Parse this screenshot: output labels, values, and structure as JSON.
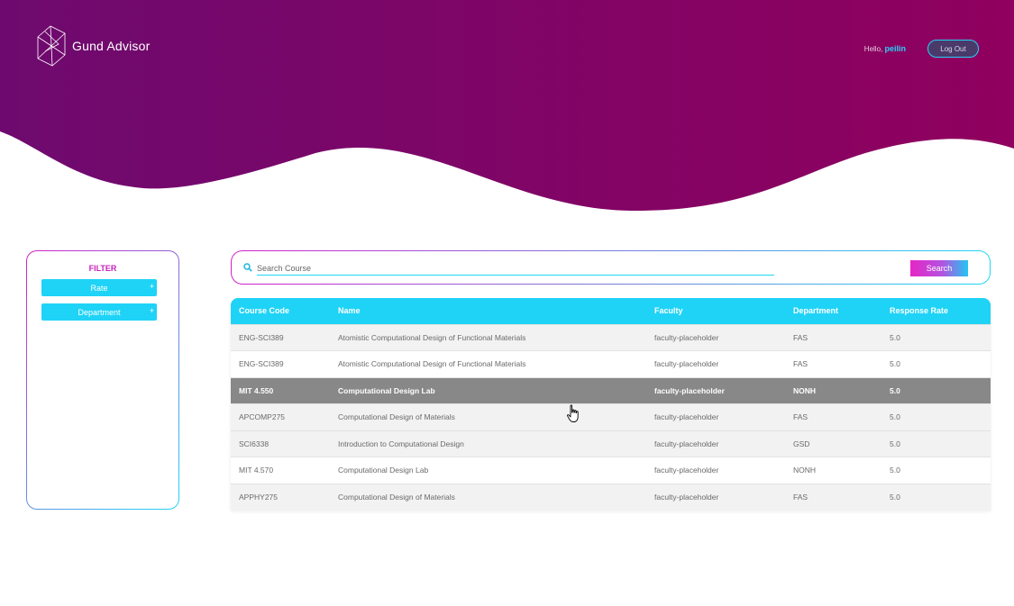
{
  "brand": {
    "name": "Gund Advisor"
  },
  "header": {
    "greeting": "Hello,",
    "username": "peilin",
    "logout_label": "Log Out"
  },
  "filter": {
    "title": "FILTER",
    "buttons": [
      {
        "label": "Rate",
        "icon": "plus-icon",
        "glyph": "+"
      },
      {
        "label": "Department",
        "icon": "plus-icon",
        "glyph": "+"
      }
    ]
  },
  "search": {
    "placeholder": "Search Course",
    "value": "",
    "button_label": "Search"
  },
  "table": {
    "columns": [
      "Course Code",
      "Name",
      "Faculty",
      "Department",
      "Response Rate"
    ],
    "rows": [
      {
        "code": "ENG-SCI389",
        "name": "Atomistic Computational Design of Functional Materials",
        "faculty": "faculty-placeholder",
        "department": "FAS",
        "rate": "5.0"
      },
      {
        "code": "ENG-SCI389",
        "name": "Atomistic Computational Design of Functional Materials",
        "faculty": "faculty-placeholder",
        "department": "FAS",
        "rate": "5.0"
      },
      {
        "code": "MIT 4.550",
        "name": "Computational Design Lab",
        "faculty": "faculty-placeholder",
        "department": "NONH",
        "rate": "5.0"
      },
      {
        "code": "APCOMP275",
        "name": "Computational Design of Materials",
        "faculty": "faculty-placeholder",
        "department": "FAS",
        "rate": "5.0"
      },
      {
        "code": "SCI6338",
        "name": "Introduction to Computational Design",
        "faculty": "faculty-placeholder",
        "department": "GSD",
        "rate": "5.0"
      },
      {
        "code": "MIT 4.570",
        "name": "Computational Design Lab",
        "faculty": "faculty-placeholder",
        "department": "NONH",
        "rate": "5.0"
      },
      {
        "code": "APPHY275",
        "name": "Computational Design of Materials",
        "faculty": "faculty-placeholder",
        "department": "FAS",
        "rate": "5.0"
      }
    ],
    "selected_row": 2
  },
  "colors": {
    "header_gradient_start": "#6e0a6f",
    "header_gradient_end": "#90005e",
    "accent_cyan": "#1fd3f6",
    "accent_magenta": "#d321c6",
    "selected_row": "#888888"
  }
}
